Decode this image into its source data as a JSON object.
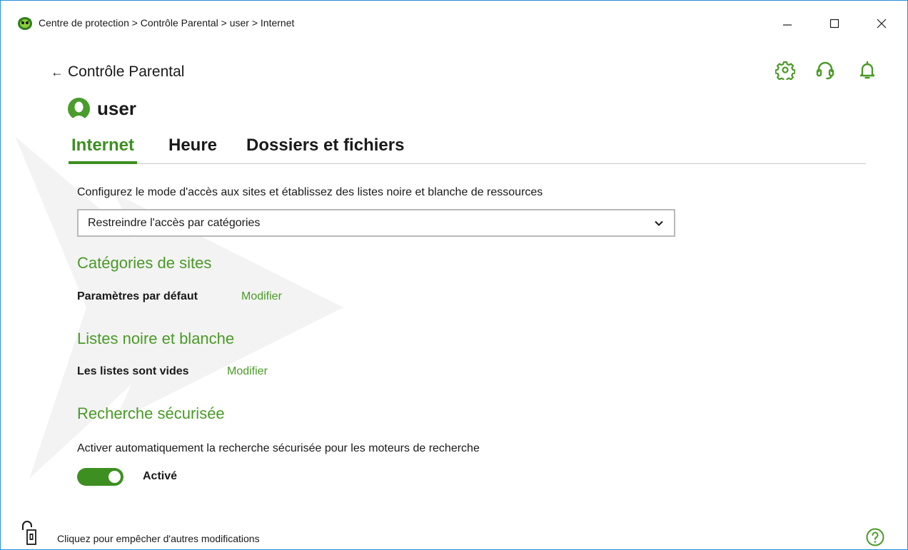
{
  "window": {
    "title": "Centre de protection > Contrôle Parental > user > Internet",
    "minimize_glyph": "—",
    "maximize_glyph": "☐",
    "close_glyph": "✕"
  },
  "header": {
    "back_label": "Contrôle Parental",
    "icons": [
      "gear-icon",
      "headset-icon",
      "bell-icon"
    ],
    "user_name": "user"
  },
  "tabs": [
    {
      "label": "Internet",
      "active": true
    },
    {
      "label": "Heure",
      "active": false
    },
    {
      "label": "Dossiers et fichiers",
      "active": false
    }
  ],
  "internet": {
    "description": "Configurez le mode d'accès aux sites et établissez des listes noire et blanche de ressources",
    "mode_selected": "Restreindre l'accès par catégories",
    "categories": {
      "title": "Catégories de sites",
      "label": "Paramètres par défaut",
      "link": "Modifier"
    },
    "lists": {
      "title": "Listes noire et blanche",
      "label": "Les listes sont vides",
      "link": "Modifier"
    },
    "safe_search": {
      "title": "Recherche sécurisée",
      "description": "Activer automatiquement la recherche sécurisée pour les moteurs de recherche",
      "enabled": true,
      "state_label": "Activé"
    }
  },
  "footer": {
    "lock_text": "Cliquez pour empêcher d'autres modifications",
    "help_icon": "question-circle-icon"
  },
  "colors": {
    "accent_green": "#4a9a27",
    "toggle_green": "#3e8f22",
    "window_border": "#2a8fd6"
  }
}
